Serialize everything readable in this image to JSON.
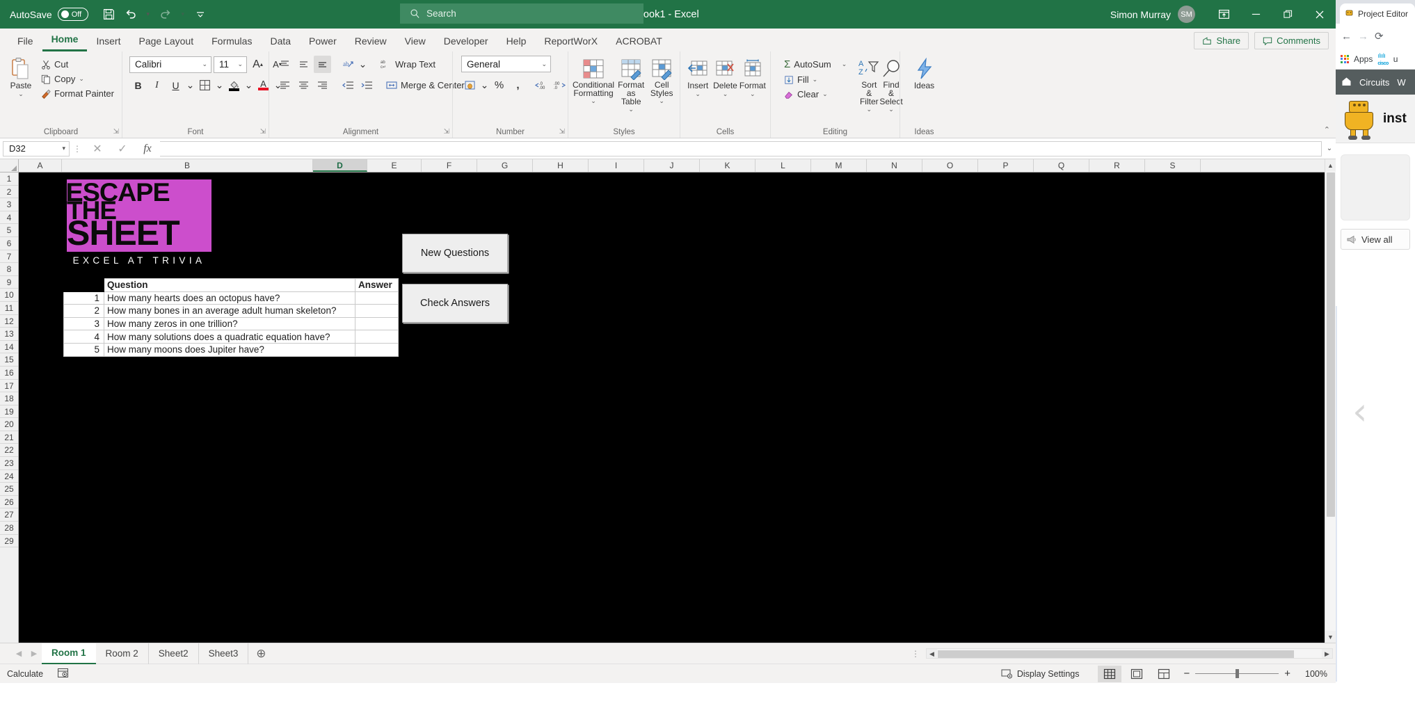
{
  "titlebar": {
    "autosave_label": "AutoSave",
    "autosave_state": "Off",
    "save_icon": "save-icon",
    "undo_icon": "undo-icon",
    "redo_icon": "redo-icon",
    "customize_icon": "customize-qat-icon",
    "document_title": "Book1  -  Excel",
    "search_placeholder": "Search",
    "search_icon": "search-icon",
    "user_name": "Simon Murray",
    "user_initials": "SM",
    "ribbon_display_icon": "ribbon-display-options-icon",
    "minimize_icon": "minimize-icon",
    "restore_icon": "restore-icon",
    "close_icon": "close-icon",
    "accent_color": "#217346"
  },
  "ribbon": {
    "tabs": [
      {
        "label": "File",
        "active": false
      },
      {
        "label": "Home",
        "active": true
      },
      {
        "label": "Insert",
        "active": false
      },
      {
        "label": "Page Layout",
        "active": false
      },
      {
        "label": "Formulas",
        "active": false
      },
      {
        "label": "Data",
        "active": false
      },
      {
        "label": "Power",
        "active": false
      },
      {
        "label": "Review",
        "active": false
      },
      {
        "label": "View",
        "active": false
      },
      {
        "label": "Developer",
        "active": false
      },
      {
        "label": "Help",
        "active": false
      },
      {
        "label": "ReportWorX",
        "active": false
      },
      {
        "label": "ACROBAT",
        "active": false
      }
    ],
    "share_label": "Share",
    "comments_label": "Comments",
    "groups": {
      "clipboard": {
        "label": "Clipboard",
        "paste": "Paste",
        "cut": "Cut",
        "copy": "Copy",
        "format_painter": "Format Painter"
      },
      "font": {
        "label": "Font",
        "font_name": "Calibri",
        "font_size": "11",
        "grow_font": "A",
        "shrink_font": "A",
        "bold": "B",
        "italic": "I",
        "underline": "U",
        "borders": "borders-icon",
        "fill_color": "fill-color-icon",
        "font_color": "font-color-icon"
      },
      "alignment": {
        "label": "Alignment",
        "wrap_text": "Wrap Text",
        "merge_center": "Merge & Center",
        "orientation": "orientation-icon",
        "top_align": "top-align-icon",
        "middle_align": "middle-align-icon",
        "bottom_align": "bottom-align-icon",
        "align_left": "align-left-icon",
        "align_center": "align-center-icon",
        "align_right": "align-right-icon",
        "decrease_indent": "decrease-indent-icon",
        "increase_indent": "increase-indent-icon"
      },
      "number": {
        "label": "Number",
        "format": "General",
        "accounting": "accounting-format-icon",
        "percent": "%",
        "comma": ",",
        "increase_decimal": "increase-decimal-icon",
        "decrease_decimal": "decrease-decimal-icon"
      },
      "styles": {
        "label": "Styles",
        "conditional_formatting": "Conditional Formatting",
        "format_as_table": "Format as Table",
        "cell_styles": "Cell Styles"
      },
      "cells": {
        "label": "Cells",
        "insert": "Insert",
        "delete": "Delete",
        "format": "Format"
      },
      "editing": {
        "label": "Editing",
        "autosum": "AutoSum",
        "fill": "Fill",
        "clear": "Clear",
        "sort_filter": "Sort & Filter",
        "find_select": "Find & Select"
      },
      "ideas": {
        "label": "Ideas",
        "ideas": "Ideas"
      }
    }
  },
  "formula_bar": {
    "name_box": "D32",
    "cancel_icon": "cancel-icon",
    "enter_icon": "enter-icon",
    "function_icon": "insert-function-icon",
    "formula_value": ""
  },
  "grid": {
    "columns": [
      "A",
      "B",
      "D",
      "E",
      "F",
      "G",
      "H",
      "I",
      "J",
      "K",
      "L",
      "M",
      "N",
      "O",
      "P",
      "Q",
      "R",
      "S"
    ],
    "selected_column": "D",
    "rows": [
      1,
      2,
      3,
      4,
      5,
      6,
      7,
      8,
      9,
      10,
      11,
      12,
      13,
      14,
      15,
      16,
      17,
      18,
      19,
      20,
      21,
      22,
      23,
      24,
      25,
      26,
      27,
      28,
      29
    ],
    "logo": {
      "line1": "ESCAPE",
      "line2": "THE",
      "line3": "SHEET",
      "subtitle": "EXCEL AT TRIVIA",
      "background_color": "#cc4ecc",
      "text_color": "#0b0b0b"
    },
    "table": {
      "headers": [
        "",
        "Question",
        "Answer"
      ],
      "rows": [
        {
          "num": "1",
          "question": "How many hearts does an octopus have?",
          "answer": ""
        },
        {
          "num": "2",
          "question": "How many bones in an average adult human skeleton?",
          "answer": ""
        },
        {
          "num": "3",
          "question": "How many zeros in one trillion?",
          "answer": ""
        },
        {
          "num": "4",
          "question": "How many solutions does a quadratic equation have?",
          "answer": ""
        },
        {
          "num": "5",
          "question": "How many moons does Jupiter have?",
          "answer": ""
        }
      ]
    },
    "buttons": {
      "new_questions": "New Questions",
      "check_answers": "Check Answers"
    }
  },
  "sheet_tabs": {
    "prev_icon": "prev-sheet-icon",
    "next_icon": "next-sheet-icon",
    "add_icon": "add-sheet-icon",
    "tabs": [
      {
        "label": "Room 1",
        "active": true
      },
      {
        "label": "Room 2",
        "active": false
      },
      {
        "label": "Sheet2",
        "active": false
      },
      {
        "label": "Sheet3",
        "active": false
      }
    ]
  },
  "status_bar": {
    "mode": "Calculate",
    "macro_icon": "record-macro-icon",
    "display_settings": "Display Settings",
    "display_settings_icon": "display-settings-icon",
    "normal_view_icon": "normal-view-icon",
    "page_layout_icon": "page-layout-view-icon",
    "page_break_icon": "page-break-view-icon",
    "zoom_out": "−",
    "zoom_in": "+",
    "zoom_level": "100%"
  },
  "browser": {
    "tab_title": "Project Editor",
    "tab_favicon": "robot-favicon",
    "back_icon": "back-arrow-icon",
    "forward_icon": "forward-arrow-icon",
    "reload_icon": "reload-icon",
    "apps_label": "Apps",
    "apps_icon": "apps-grid-icon",
    "bookmark_cisco": "cisco-icon",
    "bookmark_text": "u",
    "home_icon": "home-icon",
    "nav_circuits": "Circuits",
    "nav_next": "W",
    "site_name": "inst",
    "view_all": "View all",
    "view_all_icon": "megaphone-icon",
    "carousel_prev_icon": "chevron-left-icon"
  }
}
